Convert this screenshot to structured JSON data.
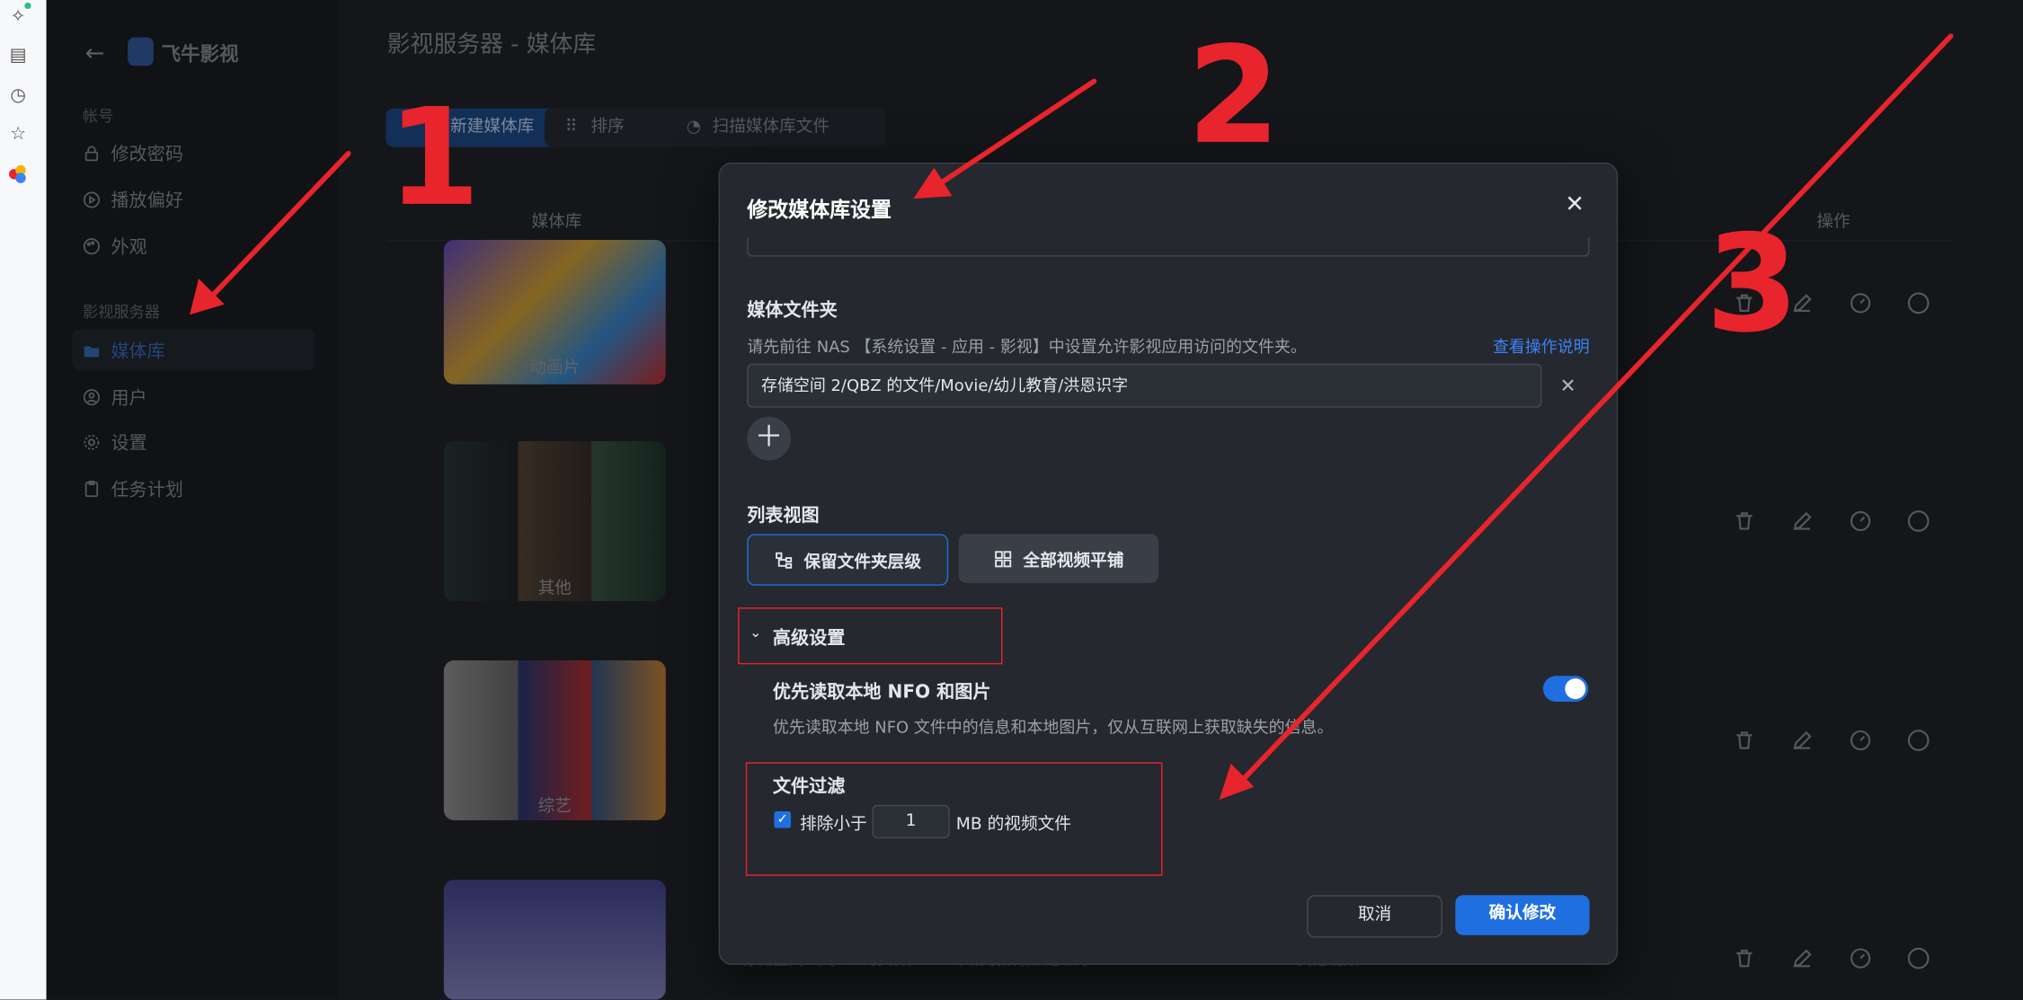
{
  "app": {
    "name": "飞牛影视"
  },
  "sidebar": {
    "sections": [
      {
        "title": "帐号",
        "items": [
          "修改密码",
          "播放偏好",
          "外观"
        ]
      },
      {
        "title": "影视服务器",
        "items": [
          "媒体库",
          "用户",
          "设置",
          "任务计划"
        ]
      }
    ]
  },
  "page": {
    "title": "影视服务器 - 媒体库",
    "toolbar": [
      "新建媒体库",
      "排序",
      "扫描媒体库文件"
    ],
    "table": {
      "headers": [
        "媒体库",
        "操作"
      ],
      "rows": [
        {
          "name": "动画片"
        },
        {
          "name": "其他"
        },
        {
          "name": "综艺"
        },
        {
          "name": "",
          "path": "存储空间 2/QBZ 的文件/Movie/幼儿教育/洪恩识字",
          "type": "其他视频",
          "date": "2025-05-04"
        }
      ]
    }
  },
  "dialog": {
    "title": "修改媒体库设置",
    "media_folder": {
      "label": "媒体文件夹",
      "hint": "请先前往 NAS 【系统设置 - 应用 - 影视】中设置允许影视应用访问的文件夹。",
      "help_link": "查看操作说明",
      "path": "存储空间 2/QBZ 的文件/Movie/幼儿教育/洪恩识字"
    },
    "list_view": {
      "label": "列表视图",
      "options": [
        "保留文件夹层级",
        "全部视频平铺"
      ],
      "selected": "保留文件夹层级"
    },
    "advanced": {
      "label": "高级设置",
      "prefer_nfo": {
        "label": "优先读取本地 NFO 和图片",
        "desc": "优先读取本地 NFO 文件中的信息和本地图片，仅从互联网上获取缺失的信息。",
        "enabled": true
      },
      "file_filter": {
        "label": "文件过滤",
        "checked": true,
        "prefix": "排除小于",
        "value": "1",
        "suffix": "MB 的视频文件"
      }
    },
    "cancel": "取消",
    "confirm": "确认修改"
  },
  "annotations": [
    "1",
    "2",
    "3"
  ],
  "colors": {
    "accent": "#1f6fe0",
    "annotation_red": "#e8242c",
    "dialog_bg": "#25282e",
    "page_bg": "#22252b",
    "sidebar_bg": "#1b1e23"
  },
  "icons": [
    "back-arrow-icon",
    "lock-icon",
    "play-circle-icon",
    "palette-icon",
    "folder-icon",
    "user-icon",
    "gear-icon",
    "clipboard-icon",
    "drag-dots-icon",
    "scan-icon",
    "trash-icon",
    "edit-icon",
    "more-icon",
    "close-icon",
    "tree-icon",
    "grid-icon",
    "chevron-down-icon"
  ]
}
